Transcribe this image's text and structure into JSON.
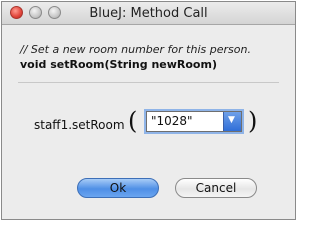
{
  "window": {
    "title": "BlueJ:  Method Call"
  },
  "dialog": {
    "comment": "// Set a new room number for this person.",
    "signature": "void setRoom(String newRoom)",
    "call_prefix": "staff1.setRoom",
    "open_paren": "(",
    "close_paren": ")",
    "argument_value": "\"1028\"",
    "ok_label": "Ok",
    "cancel_label": "Cancel"
  },
  "icons": [
    "close-icon",
    "minimize-icon",
    "zoom-icon",
    "chevron-down-icon"
  ]
}
